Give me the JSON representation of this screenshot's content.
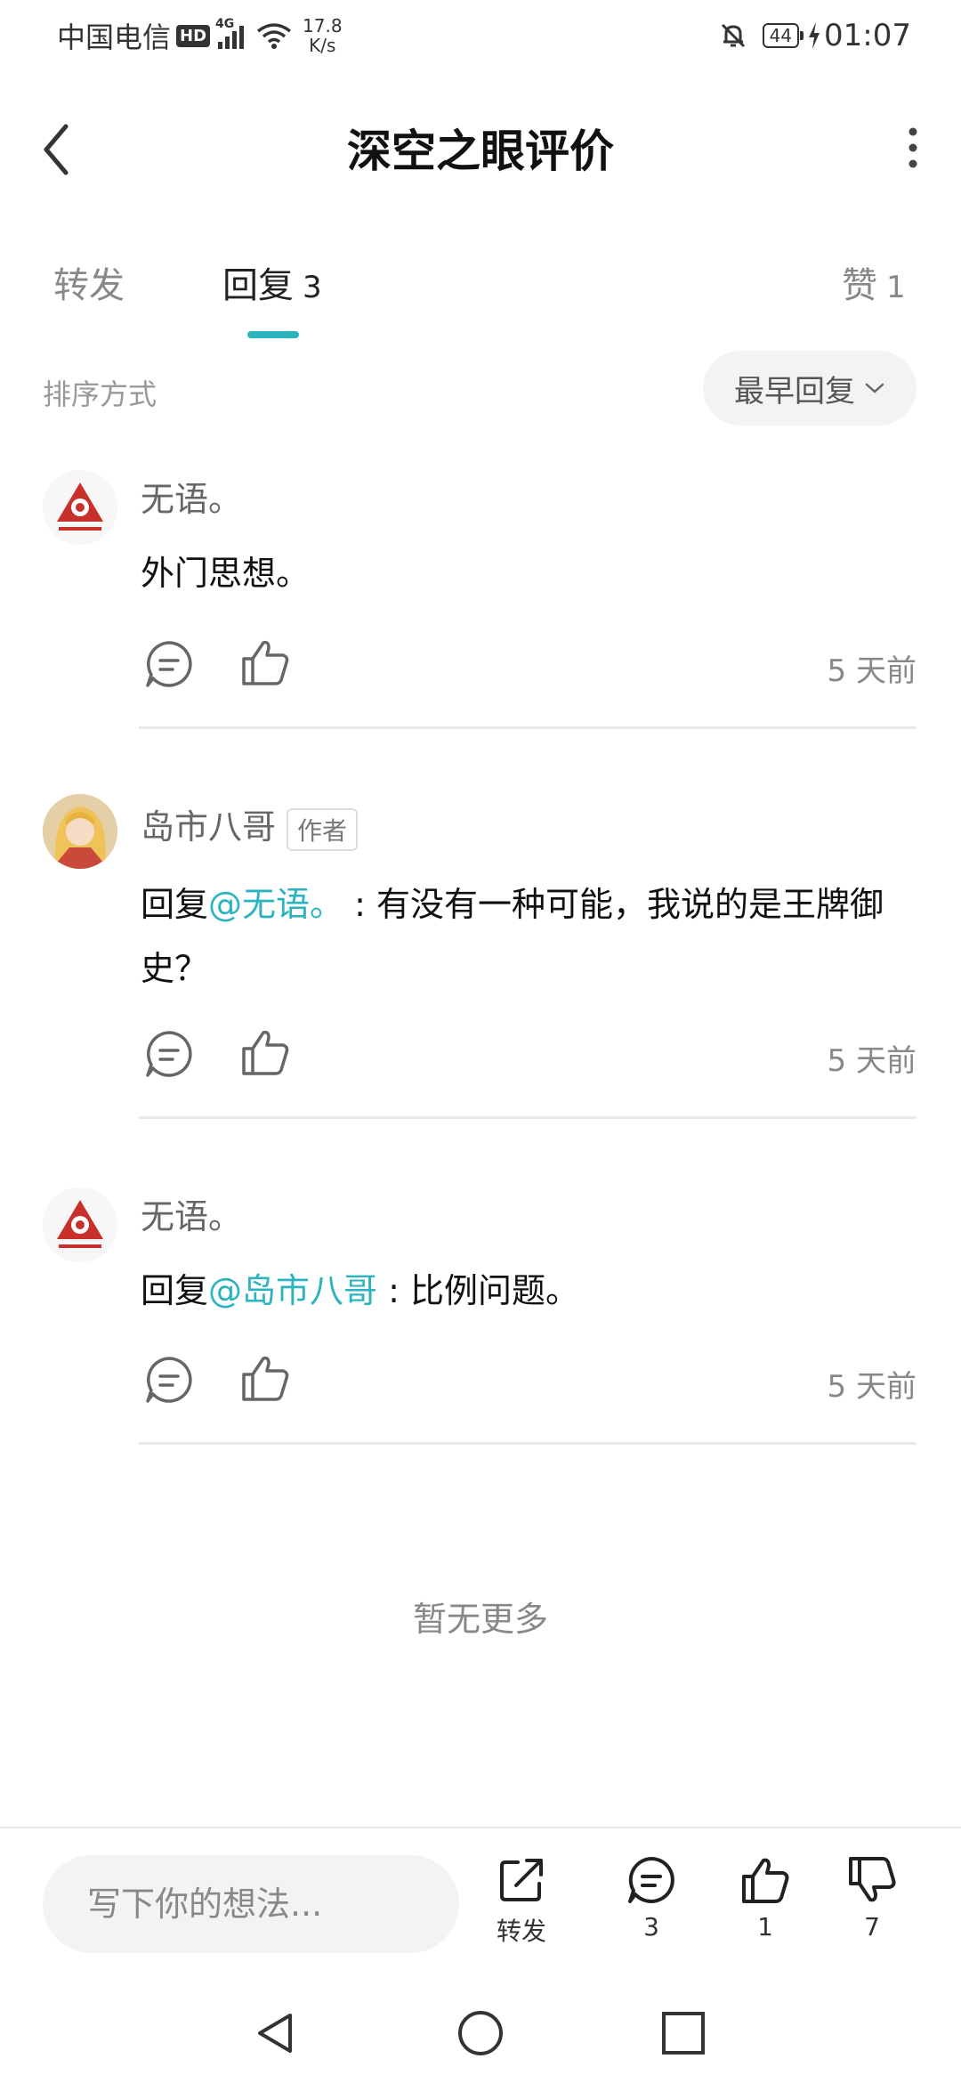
{
  "status_bar": {
    "carrier": "中国电信",
    "hd_badge": "HD",
    "network": "4G",
    "speed_value": "17.8",
    "speed_unit": "K/s",
    "battery": "44",
    "time": "01:07"
  },
  "header": {
    "title": "深空之眼评价"
  },
  "tabs": [
    {
      "label": "转发",
      "count": ""
    },
    {
      "label": "回复",
      "count": "3"
    },
    {
      "label": "赞",
      "count": "1"
    }
  ],
  "sort": {
    "label": "排序方式",
    "value": "最早回复"
  },
  "comments": [
    {
      "user": "无语。",
      "author_tag": "",
      "reply_prefix": "",
      "mention": "",
      "separator": "",
      "text": "外门思想。",
      "time": "5 天前"
    },
    {
      "user": "岛市八哥",
      "author_tag": "作者",
      "reply_prefix": "回复",
      "mention": "@无语。",
      "separator": " : ",
      "text": "有没有一种可能，我说的是王牌御史？",
      "time": "5 天前"
    },
    {
      "user": "无语。",
      "author_tag": "",
      "reply_prefix": "回复",
      "mention": "@岛市八哥",
      "separator": " : ",
      "text": "比例问题。",
      "time": "5 天前"
    }
  ],
  "footer_note": "暂无更多",
  "bottom_bar": {
    "input_placeholder": "写下你的想法...",
    "share_label": "转发",
    "comment_count": "3",
    "like_count": "1",
    "dislike_count": "7"
  },
  "colors": {
    "accent": "#2bb3c0",
    "avatar_red": "#c8302c"
  }
}
